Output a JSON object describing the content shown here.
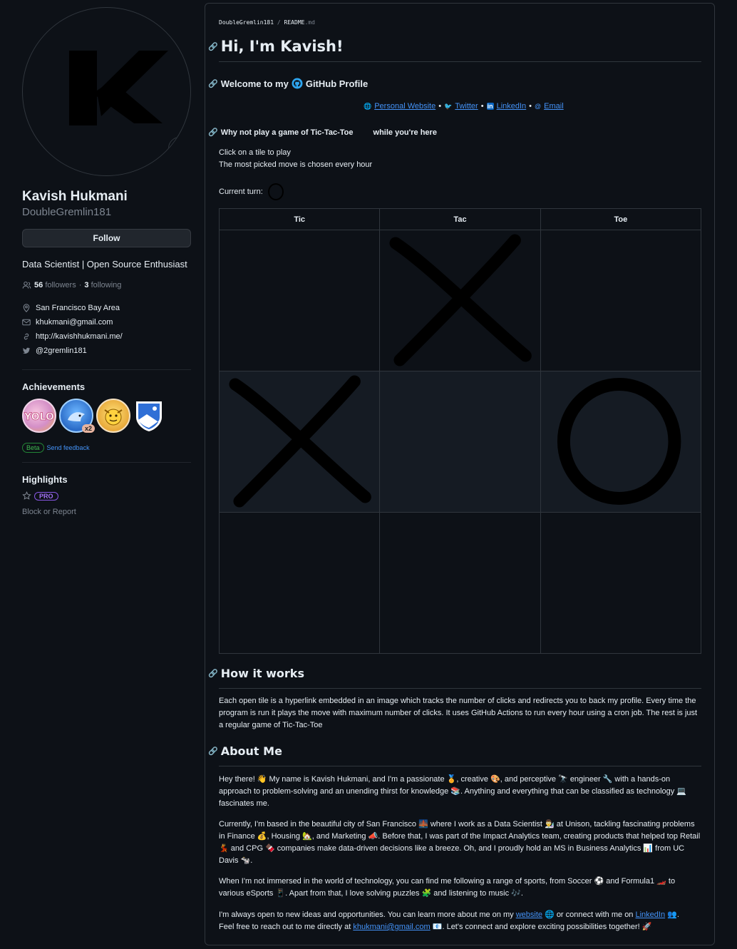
{
  "profile": {
    "name": "Kavish Hukmani",
    "login": "DoubleGremlin181",
    "status_icon": "laptop-icon",
    "follow_label": "Follow",
    "bio": "Data Scientist | Open Source Enthusiast",
    "followers_count": "56",
    "followers_label": "followers",
    "separator": "·",
    "following_count": "3",
    "following_label": "following",
    "location": "San Francisco Bay Area",
    "email": "khukmani@gmail.com",
    "website": "http://kavishhukmani.me/",
    "twitter": "@2gremlin181"
  },
  "achievements": {
    "heading": "Achievements",
    "badge_multiplier": "x2",
    "beta_label": "Beta",
    "feedback_label": "Send feedback"
  },
  "highlights": {
    "heading": "Highlights",
    "pro_label": "PRO",
    "block_label": "Block or Report"
  },
  "readme": {
    "crumb_repo": "DoubleGremlin181",
    "crumb_sep": "/",
    "crumb_file": "README",
    "crumb_ext": ".md",
    "title": "Hi, I'm Kavish!",
    "welcome_pre": "Welcome to my",
    "welcome_post": "GitHub Profile",
    "links": [
      "Personal Website",
      "Twitter",
      "LinkedIn",
      "Email"
    ],
    "link_sep": "•",
    "game_pre": "Why not play a game of Tic-Tac-Toe",
    "game_post": "while you're here",
    "click_line": "Click on a tile to play",
    "picked_line": "The most picked move is chosen every hour",
    "turn_label": "Current turn:",
    "columns": [
      "Tic",
      "Tac",
      "Toe"
    ],
    "board": [
      [
        "",
        "X",
        ""
      ],
      [
        "X",
        "",
        "O"
      ],
      [
        "",
        "",
        ""
      ]
    ],
    "how_heading": "How it works",
    "how_text": "Each open tile is a hyperlink embedded in an image which tracks the number of clicks and redirects you to back my profile. Every time the program is run it plays the move with maximum number of clicks. It uses GitHub Actions to run every hour using a cron job. The rest is just a regular game of Tic-Tac-Toe",
    "about_heading": "About Me",
    "about_p1": "Hey there! 👋 My name is Kavish Hukmani, and I'm a passionate 🏅, creative 🎨, and perceptive 🔭 engineer 🔧 with a hands-on approach to problem-solving and an unending thirst for knowledge 📚. Anything and everything that can be classified as technology 💻 fascinates me.",
    "about_p2": "Currently, I'm based in the beautiful city of San Francisco 🌉 where I work as a Data Scientist 👨‍🔬 at Unison, tackling fascinating problems in Finance 💰, Housing 🏡, and Marketing 📣. Before that, I was part of the Impact Analytics team, creating products that helped top Retail 💃 and CPG 🍫 companies make data-driven decisions like a breeze. Oh, and I proudly hold an MS in Business Analytics 📊 from UC Davis 🐄.",
    "about_p3": "When I'm not immersed in the world of technology, you can find me following a range of sports, from Soccer ⚽ and Formula1 🏎️ to various eSports 📱. Apart from that, I love solving puzzles 🧩 and listening to music 🎶.",
    "about_p4_a": "I'm always open to new ideas and opportunities. You can learn more about me on my",
    "about_p4_link1": "website",
    "about_p4_b": "🌐 or connect with me on",
    "about_p4_link2": "LinkedIn",
    "about_p4_c": "👥.",
    "about_p5_a": "Feel free to reach out to me directly at",
    "about_p5_link": "khukmani@gmail.com",
    "about_p5_b": "📧. Let's connect and explore exciting possibilities together! 🚀"
  },
  "colors": {
    "background": "#0d1117",
    "border": "#30363d",
    "text": "#e6edf3",
    "muted": "#7d8590",
    "link": "#4493f8",
    "alt_row": "#151b23"
  }
}
